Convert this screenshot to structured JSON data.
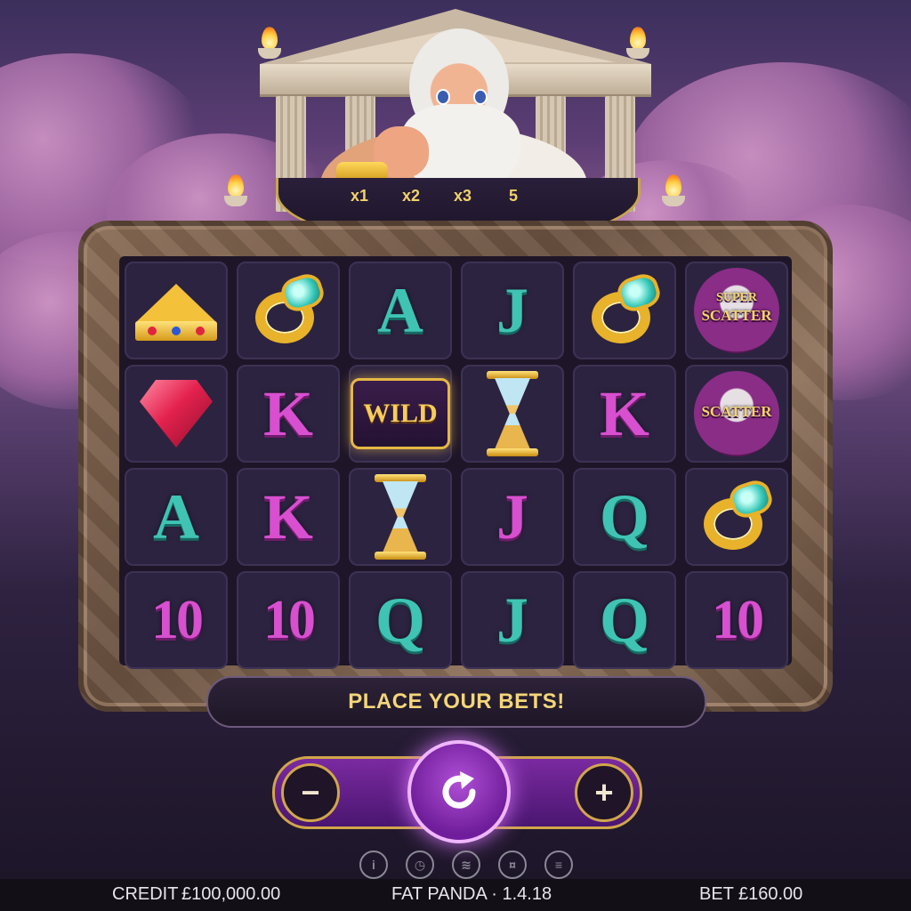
{
  "multipliers": [
    "x1",
    "x2",
    "x3",
    "5"
  ],
  "grid": [
    [
      {
        "type": "crown",
        "icon": "crown-icon"
      },
      {
        "type": "ring",
        "icon": "ring-icon"
      },
      {
        "type": "letter",
        "text": "A",
        "color": "teal"
      },
      {
        "type": "letter",
        "text": "J",
        "color": "teal"
      },
      {
        "type": "ring",
        "icon": "ring-icon"
      },
      {
        "type": "scatter",
        "label_top": "SUPER",
        "label": "SCATTER"
      }
    ],
    [
      {
        "type": "gem",
        "icon": "ruby-icon"
      },
      {
        "type": "letter",
        "text": "K",
        "color": "magenta"
      },
      {
        "type": "wild",
        "text": "WILD"
      },
      {
        "type": "hourglass",
        "icon": "hourglass-icon"
      },
      {
        "type": "letter",
        "text": "K",
        "color": "magenta"
      },
      {
        "type": "scatter",
        "label": "SCATTER"
      }
    ],
    [
      {
        "type": "letter",
        "text": "A",
        "color": "teal"
      },
      {
        "type": "letter",
        "text": "K",
        "color": "magenta"
      },
      {
        "type": "hourglass",
        "icon": "hourglass-icon"
      },
      {
        "type": "letter",
        "text": "J",
        "color": "magenta"
      },
      {
        "type": "letter",
        "text": "Q",
        "color": "teal"
      },
      {
        "type": "ring",
        "icon": "ring-icon"
      }
    ],
    [
      {
        "type": "letter",
        "text": "10",
        "color": "magenta"
      },
      {
        "type": "letter",
        "text": "10",
        "color": "magenta"
      },
      {
        "type": "letter",
        "text": "Q",
        "color": "teal"
      },
      {
        "type": "letter",
        "text": "J",
        "color": "teal"
      },
      {
        "type": "letter",
        "text": "Q",
        "color": "teal"
      },
      {
        "type": "letter",
        "text": "10",
        "color": "magenta"
      }
    ]
  ],
  "banner": "PLACE YOUR BETS!",
  "controls": {
    "minus": "−",
    "plus": "+",
    "spin_icon": "refresh-icon"
  },
  "bottom_icons": [
    "info-icon",
    "autoplay-icon",
    "turbo-icon",
    "coins-icon",
    "bet-settings-icon"
  ],
  "footer": {
    "credit_label": "CREDIT",
    "credit_value": "£100,000.00",
    "game_name": "FAT PANDA · 1.4.18",
    "bet_label": "BET",
    "bet_value": "£160.00"
  },
  "colors": {
    "gold": "#f3d67a",
    "teal": "#3fc4b4",
    "magenta": "#d84fd0",
    "purple": "#6f1d9a"
  }
}
